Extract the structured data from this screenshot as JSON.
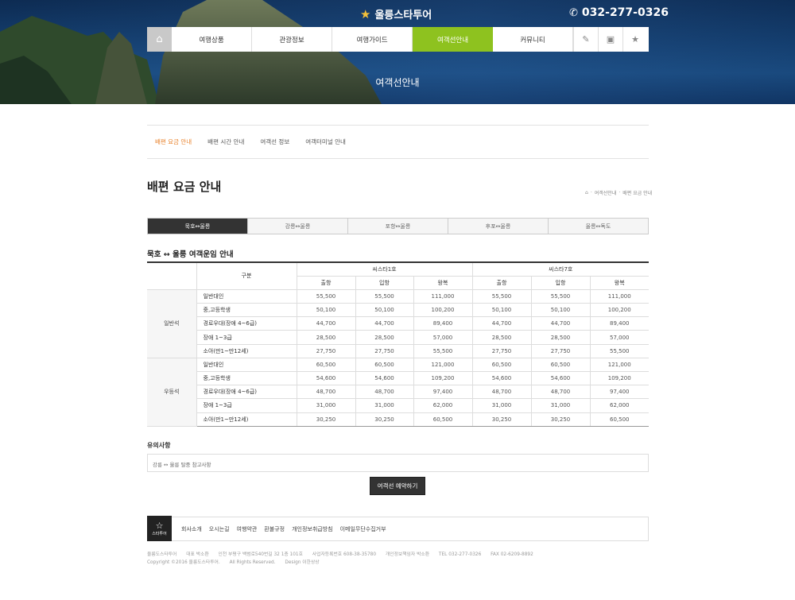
{
  "header": {
    "logo_text": "울릉스타투어",
    "phone": "032-277-0326",
    "hero_title": "여객선안내"
  },
  "gnb": {
    "menus": [
      "여행상품",
      "관광정보",
      "여행가이드",
      "여객선안내",
      "커뮤니티"
    ],
    "active_index": 3,
    "tools": [
      "edit-icon",
      "calendar-icon",
      "star-icon"
    ]
  },
  "subnav": [
    "배편 요금 안내",
    "배편 시간 안내",
    "여객선 정보",
    "여객터미널 안내"
  ],
  "page": {
    "title": "배편 요금 안내",
    "breadcrumb": [
      "여객선안내",
      "배편 요금 안내"
    ]
  },
  "tabs": [
    "묵호↔울릉",
    "강릉↔울릉",
    "포항↔울릉",
    "후포↔울릉",
    "울릉↔독도"
  ],
  "section_title": "묵호 ↔ 울릉 여객운임 안내",
  "table": {
    "head_label": "구분",
    "ships": [
      "씨스타1호",
      "씨스타7호"
    ],
    "cols": [
      "출항",
      "입항",
      "왕복"
    ],
    "groups": [
      {
        "name": "일반석",
        "rows": [
          {
            "label": "일반대인",
            "v": [
              "55,500",
              "55,500",
              "111,000",
              "55,500",
              "55,500",
              "111,000"
            ]
          },
          {
            "label": "중,고등학생",
            "v": [
              "50,100",
              "50,100",
              "100,200",
              "50,100",
              "50,100",
              "100,200"
            ]
          },
          {
            "label": "경로우대(장애 4~6급)",
            "v": [
              "44,700",
              "44,700",
              "89,400",
              "44,700",
              "44,700",
              "89,400"
            ]
          },
          {
            "label": "장애 1~3급",
            "v": [
              "28,500",
              "28,500",
              "57,000",
              "28,500",
              "28,500",
              "57,000"
            ]
          },
          {
            "label": "소아(만1~만12세)",
            "v": [
              "27,750",
              "27,750",
              "55,500",
              "27,750",
              "27,750",
              "55,500"
            ]
          }
        ]
      },
      {
        "name": "우등석",
        "rows": [
          {
            "label": "일반대인",
            "v": [
              "60,500",
              "60,500",
              "121,000",
              "60,500",
              "60,500",
              "121,000"
            ]
          },
          {
            "label": "중,고등학생",
            "v": [
              "54,600",
              "54,600",
              "109,200",
              "54,600",
              "54,600",
              "109,200"
            ]
          },
          {
            "label": "경로우대(장애 4~6급)",
            "v": [
              "48,700",
              "48,700",
              "97,400",
              "48,700",
              "48,700",
              "97,400"
            ]
          },
          {
            "label": "장애 1~3급",
            "v": [
              "31,000",
              "31,000",
              "62,000",
              "31,000",
              "31,000",
              "62,000"
            ]
          },
          {
            "label": "소아(만1~만12세)",
            "v": [
              "30,250",
              "30,250",
              "60,500",
              "30,250",
              "30,250",
              "60,500"
            ]
          }
        ]
      }
    ]
  },
  "notice": {
    "title": "유의사항",
    "text": "강릉 ↔ 울릉 탈중 참고사항"
  },
  "reserve_button": "여객선 예약하기",
  "footer": {
    "logo_text": "스타투어",
    "links": [
      "회사소개",
      "오시는길",
      "여행약관",
      "환불규정",
      "개인정보취급방침",
      "이메일무단수집거부"
    ],
    "info": [
      "울릉도스타투어",
      "대표 박소환",
      "인천 부평구 백범로540번길 32 1층 101호",
      "사업자등록번호 608-38-35780",
      "개인정보책임자 박소환",
      "TEL 032-277-0326",
      "FAX 02-6209-8892"
    ],
    "copyright": [
      "Copyright ©2016 울릉도스타투어.",
      "All Rights Reserved.",
      "Design 이한상상"
    ]
  }
}
